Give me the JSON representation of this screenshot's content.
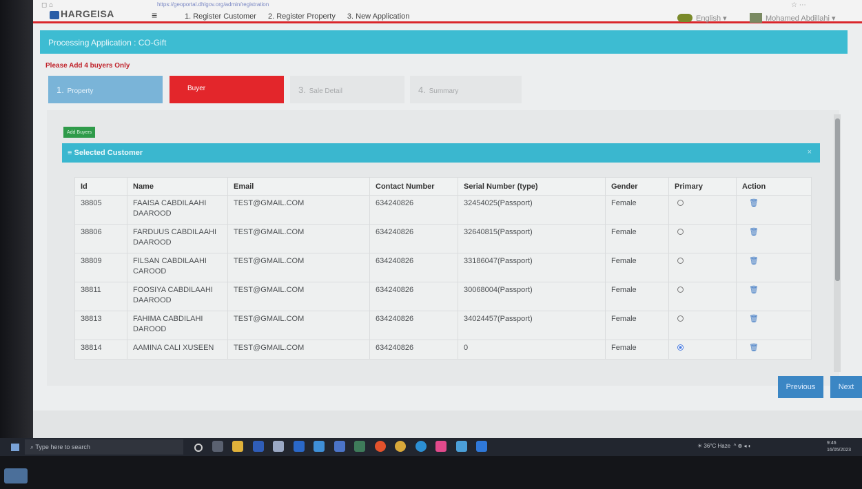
{
  "browser": {
    "url": "https://geoportal.dhlgov.org/admin/registration"
  },
  "app": {
    "logo": "HARGEISA",
    "nav": [
      "1. Register Customer",
      "2. Register Property",
      "3. New Application"
    ],
    "language": "English",
    "user": "Mohamed Abdillahi"
  },
  "page": {
    "title": "Processing Application : CO-Gift",
    "warning": "Please Add 4 buyers Only",
    "steps": [
      {
        "num": "1.",
        "label": "Property"
      },
      {
        "num": "",
        "label": "Buyer"
      },
      {
        "num": "3.",
        "label": "Sale Detail"
      },
      {
        "num": "4.",
        "label": "Summary"
      }
    ],
    "add_buyer_label": "Add Buyers",
    "panel_title": "Selected Customer",
    "previous_label": "Previous",
    "next_label": "Next"
  },
  "table": {
    "headers": [
      "Id",
      "Name",
      "Email",
      "Contact Number",
      "Serial Number (type)",
      "Gender",
      "Primary",
      "Action"
    ],
    "rows": [
      {
        "id": "38805",
        "name": "FAAISA CABDILAAHI DAAROOD",
        "email": "TEST@GMAIL.COM",
        "contact": "634240826",
        "serial": "32454025(Passport)",
        "gender": "Female",
        "primary": false
      },
      {
        "id": "38806",
        "name": "FARDUUS CABDILAAHI DAAROOD",
        "email": "TEST@GMAIL.COM",
        "contact": "634240826",
        "serial": "32640815(Passport)",
        "gender": "Female",
        "primary": false
      },
      {
        "id": "38809",
        "name": "FILSAN CABDILAAHI CAROOD",
        "email": "TEST@GMAIL.COM",
        "contact": "634240826",
        "serial": "33186047(Passport)",
        "gender": "Female",
        "primary": false
      },
      {
        "id": "38811",
        "name": "FOOSIYA CABDILAAHI DAAROOD",
        "email": "TEST@GMAIL.COM",
        "contact": "634240826",
        "serial": "30068004(Passport)",
        "gender": "Female",
        "primary": false
      },
      {
        "id": "38813",
        "name": "FAHIMA CABDILAHI DAROOD",
        "email": "TEST@GMAIL.COM",
        "contact": "634240826",
        "serial": "34024457(Passport)",
        "gender": "Female",
        "primary": false
      },
      {
        "id": "38814",
        "name": "AAMINA CALI XUSEEN",
        "email": "TEST@GMAIL.COM",
        "contact": "634240826",
        "serial": "0",
        "gender": "Female",
        "primary": true
      }
    ]
  },
  "taskbar": {
    "search_placeholder": "Type here to search",
    "weather": "36°C Haze",
    "clock_time": "9:46",
    "clock_date": "16/05/2023"
  },
  "colors": {
    "accent_cyan": "#3dbcd2",
    "active_step": "#e3262b",
    "button_blue": "#3b86c4",
    "add_button_green": "#2f9b4a"
  }
}
